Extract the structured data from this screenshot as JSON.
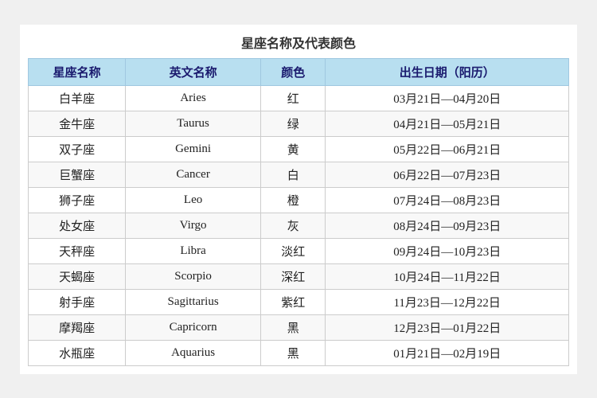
{
  "title": "星座名称及代表颜色",
  "headers": {
    "zh_name": "星座名称",
    "en_name": "英文名称",
    "color": "颜色",
    "date": "出生日期（阳历）"
  },
  "rows": [
    {
      "zh": "白羊座",
      "en": "Aries",
      "color": "红",
      "date": "03月21日—04月20日"
    },
    {
      "zh": "金牛座",
      "en": "Taurus",
      "color": "绿",
      "date": "04月21日—05月21日"
    },
    {
      "zh": "双子座",
      "en": "Gemini",
      "color": "黄",
      "date": "05月22日—06月21日"
    },
    {
      "zh": "巨蟹座",
      "en": "Cancer",
      "color": "白",
      "date": "06月22日—07月23日"
    },
    {
      "zh": "狮子座",
      "en": "Leo",
      "color": "橙",
      "date": "07月24日—08月23日"
    },
    {
      "zh": "处女座",
      "en": "Virgo",
      "color": "灰",
      "date": "08月24日—09月23日"
    },
    {
      "zh": "天秤座",
      "en": "Libra",
      "color": "淡红",
      "date": "09月24日—10月23日"
    },
    {
      "zh": "天蝎座",
      "en": "Scorpio",
      "color": "深红",
      "date": "10月24日—11月22日"
    },
    {
      "zh": "射手座",
      "en": "Sagittarius",
      "color": "紫红",
      "date": "11月23日—12月22日"
    },
    {
      "zh": "摩羯座",
      "en": "Capricorn",
      "color": "黑",
      "date": "12月23日—01月22日"
    },
    {
      "zh": "水瓶座",
      "en": "Aquarius",
      "color": "黑",
      "date": "01月21日—02月19日"
    }
  ]
}
